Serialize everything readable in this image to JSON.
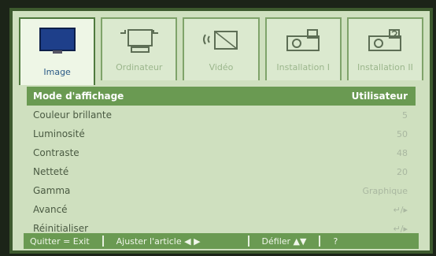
{
  "tabs": [
    {
      "label": "Image",
      "icon": "monitor-icon",
      "active": true
    },
    {
      "label": "Ordinateur",
      "icon": "computer-icon",
      "active": false
    },
    {
      "label": "Vidéo",
      "icon": "video-signal-icon",
      "active": false
    },
    {
      "label": "Installation I",
      "icon": "projector-icon",
      "active": false
    },
    {
      "label": "Installation II",
      "icon": "projector-help-icon",
      "active": false
    }
  ],
  "menu": [
    {
      "label": "Mode d'affichage",
      "value": "Utilisateur"
    },
    {
      "label": "Couleur brillante",
      "value": "5"
    },
    {
      "label": "Luminosité",
      "value": "50"
    },
    {
      "label": "Contraste",
      "value": "48"
    },
    {
      "label": "Netteté",
      "value": "20"
    },
    {
      "label": "Gamma",
      "value": "Graphique"
    },
    {
      "label": "Avancé",
      "value": "↵/▸"
    },
    {
      "label": "Réinitialiser",
      "value": "↵/▸"
    }
  ],
  "status": {
    "quit": "Quitter = Exit",
    "adjust": "Ajuster l'article ◀ ▶",
    "scroll": "Défiler ▲▼",
    "info": "?"
  },
  "colors": {
    "background": "#cfe0bf",
    "selected_row": "#6a9a52",
    "frame": "#3d5a2e"
  }
}
